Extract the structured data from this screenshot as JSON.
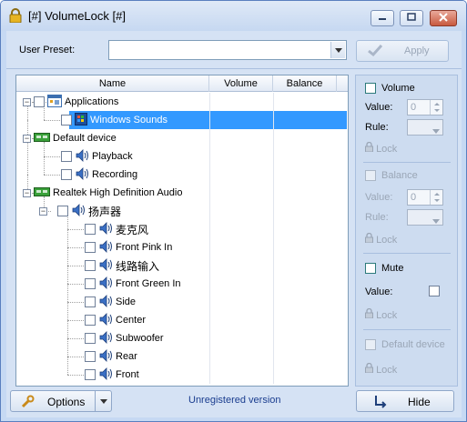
{
  "window": {
    "title": "[#] VolumeLock [#]"
  },
  "preset": {
    "label": "User Preset:",
    "value": "",
    "apply_label": "Apply"
  },
  "tree": {
    "columns": [
      "Name",
      "Volume",
      "Balance"
    ],
    "rows": [
      {
        "label": "Applications"
      },
      {
        "label": "Windows Sounds"
      },
      {
        "label": "Default device"
      },
      {
        "label": "Playback"
      },
      {
        "label": "Recording"
      },
      {
        "label": "Realtek High Definition Audio"
      },
      {
        "label": "扬声器"
      },
      {
        "label": "麦克风"
      },
      {
        "label": "Front Pink In"
      },
      {
        "label": "线路输入"
      },
      {
        "label": "Front Green In"
      },
      {
        "label": "Side"
      },
      {
        "label": "Center"
      },
      {
        "label": "Subwoofer"
      },
      {
        "label": "Rear"
      },
      {
        "label": "Front"
      }
    ]
  },
  "side": {
    "volume_label": "Volume",
    "value_label": "Value:",
    "value": "0",
    "rule_label": "Rule:",
    "lock_label": "Lock",
    "balance_label": "Balance",
    "balance_value_label": "Value:",
    "balance_value": "0",
    "balance_rule_label": "Rule:",
    "balance_lock_label": "Lock",
    "mute_label": "Mute",
    "mute_value_label": "Value:",
    "mute_lock_label": "Lock",
    "default_device_label": "Default device",
    "default_lock_label": "Lock"
  },
  "bottom": {
    "options_label": "Options",
    "status": "Unregistered version",
    "hide_label": "Hide"
  },
  "colors": {
    "selection": "#3399ff",
    "accent": "#1a3d8f",
    "window_bg": "#d5e2f4"
  },
  "icons": [
    "lock-icon",
    "minimize-icon",
    "maximize-icon",
    "close-icon",
    "check-icon",
    "app-window-icon",
    "device-card-icon",
    "speaker-icon",
    "wrench-icon",
    "hide-icon"
  ]
}
